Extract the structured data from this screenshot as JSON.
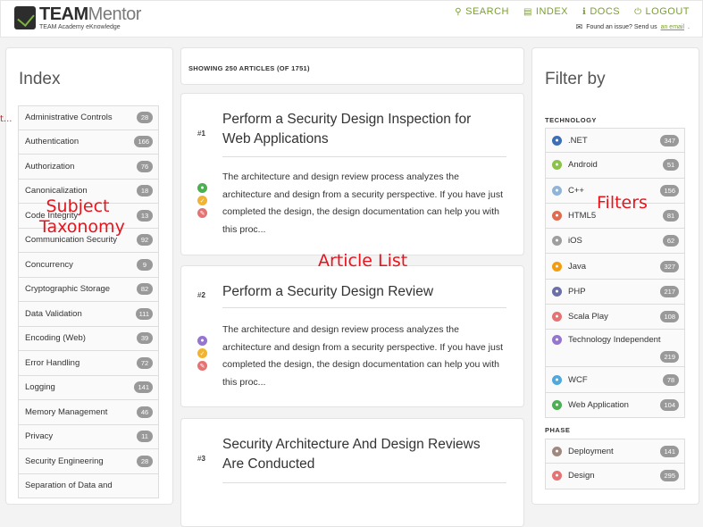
{
  "header": {
    "logo_title": "TEAM",
    "logo_title_suffix": "Mentor",
    "logo_subtitle": "TEAM Academy eKnowledge",
    "nav": [
      {
        "label": "SEARCH",
        "icon": "search-icon"
      },
      {
        "label": "INDEX",
        "icon": "folder-icon"
      },
      {
        "label": "DOCS",
        "icon": "info-icon"
      },
      {
        "label": "LOGOUT",
        "icon": "power-icon"
      }
    ],
    "issue_text": "Found an issue? Send us",
    "issue_link": "an email",
    "issue_end": "."
  },
  "index": {
    "title": "Index",
    "items": [
      {
        "label": "Administrative Controls",
        "count": "28"
      },
      {
        "label": "Authentication",
        "count": "166"
      },
      {
        "label": "Authorization",
        "count": "76"
      },
      {
        "label": "Canonicalization",
        "count": "18"
      },
      {
        "label": "Code Integrity",
        "count": "13"
      },
      {
        "label": "Communication Security",
        "count": "92"
      },
      {
        "label": "Concurrency",
        "count": "9"
      },
      {
        "label": "Cryptographic Storage",
        "count": "82"
      },
      {
        "label": "Data Validation",
        "count": "111"
      },
      {
        "label": "Encoding (Web)",
        "count": "39"
      },
      {
        "label": "Error Handling",
        "count": "72"
      },
      {
        "label": "Logging",
        "count": "141"
      },
      {
        "label": "Memory Management",
        "count": "46"
      },
      {
        "label": "Privacy",
        "count": "11"
      },
      {
        "label": "Security Engineering",
        "count": "28"
      },
      {
        "label": "Separation of Data and",
        "count": ""
      }
    ]
  },
  "showing": "SHOWING 250 ARTICLES (OF 1751)",
  "articles": [
    {
      "num_prefix": "#",
      "num": "1",
      "title": "Perform a Security Design Inspection for Web Applications",
      "desc": "The architecture and design review process analyzes the architecture and design from a security perspective. If you have just completed the design, the design documentation can help you with this proc..."
    },
    {
      "num_prefix": "#",
      "num": "2",
      "title": "Perform a Security Design Review",
      "desc": "The architecture and design review process analyzes the architecture and design from a security perspective. If you have just completed the design, the design documentation can help you with this proc..."
    },
    {
      "num_prefix": "#",
      "num": "3",
      "title": "Security Architecture And Design Reviews Are Conducted",
      "desc": ""
    }
  ],
  "filters": {
    "title": "Filter by",
    "technology_label": "TECHNOLOGY",
    "technology": [
      {
        "label": ".NET",
        "count": "347",
        "icon": "dotnet-icon",
        "color": "#3b6fb6"
      },
      {
        "label": "Android",
        "count": "51",
        "icon": "android-icon",
        "color": "#8bc34a"
      },
      {
        "label": "C++",
        "count": "156",
        "icon": "cpp-icon",
        "color": "#90b4d9"
      },
      {
        "label": "HTML5",
        "count": "81",
        "icon": "html5-icon",
        "color": "#e06b4d"
      },
      {
        "label": "iOS",
        "count": "62",
        "icon": "apple-icon",
        "color": "#9e9e9e"
      },
      {
        "label": "Java",
        "count": "327",
        "icon": "java-icon",
        "color": "#f39c12"
      },
      {
        "label": "PHP",
        "count": "217",
        "icon": "php-icon",
        "color": "#6c6fa8"
      },
      {
        "label": "Scala Play",
        "count": "108",
        "icon": "scala-icon",
        "color": "#e57373"
      },
      {
        "label": "Technology Independent",
        "count": "219",
        "icon": "tech-independent-icon",
        "color": "#9575cd"
      },
      {
        "label": "WCF",
        "count": "78",
        "icon": "wcf-icon",
        "color": "#4fa9dc"
      },
      {
        "label": "Web Application",
        "count": "104",
        "icon": "web-app-icon",
        "color": "#4caf50"
      }
    ],
    "phase_label": "PHASE",
    "phase": [
      {
        "label": "Deployment",
        "count": "141",
        "icon": "deployment-icon",
        "color": "#a1887f"
      },
      {
        "label": "Design",
        "count": "295",
        "icon": "design-icon",
        "color": "#e57373"
      }
    ]
  },
  "annotations": {
    "subject_line1": "Subject",
    "subject_line2": "Taxonomy",
    "article_list": "Article List",
    "filters": "Filters",
    "left_edge": "t..."
  },
  "colors": {
    "accent": "#7aa02e",
    "annotation": "#e8141c",
    "badge": "#999999"
  }
}
